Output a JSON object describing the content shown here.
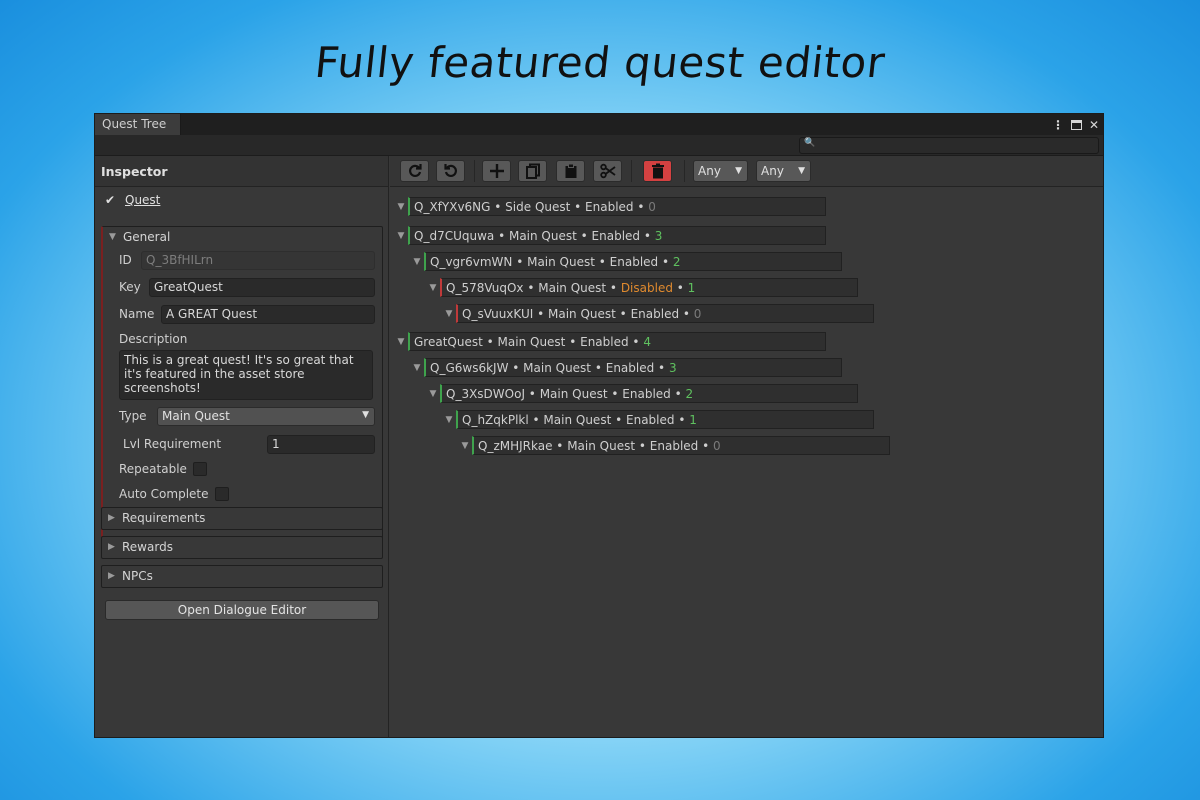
{
  "banner": "Fully featured quest editor",
  "window": {
    "tab": "Quest Tree",
    "controls": {
      "menu": "⋮",
      "close": "✕"
    }
  },
  "inspector": {
    "title": "Inspector",
    "quest_label": "Quest",
    "general": {
      "label": "General",
      "id_label": "ID",
      "id_value": "Q_3BfHILrn",
      "key_label": "Key",
      "key_value": "GreatQuest",
      "name_label": "Name",
      "name_value": "A GREAT Quest",
      "description_label": "Description",
      "description_value": "This is a great quest! It's so great that it's featured in the asset store screenshots!",
      "type_label": "Type",
      "type_value": "Main Quest",
      "lvl_label": "Lvl Requirement",
      "lvl_value": "1",
      "repeatable_label": "Repeatable",
      "autocomplete_label": "Auto Complete"
    },
    "sections": [
      "Requirements",
      "Rewards",
      "NPCs"
    ],
    "open_dialogue": "Open Dialogue Editor"
  },
  "toolbar": {
    "filter1": "Any",
    "filter2": "Any"
  },
  "tree": [
    {
      "id": "Q_XfYXv6NG",
      "type": "Side Quest",
      "status": "Enabled",
      "count": "0"
    },
    {
      "id": "Q_d7CUquwa",
      "type": "Main Quest",
      "status": "Enabled",
      "count": "3"
    },
    {
      "id": "Q_vgr6vmWN",
      "type": "Main Quest",
      "status": "Enabled",
      "count": "2"
    },
    {
      "id": "Q_578VuqOx",
      "type": "Main Quest",
      "status": "Disabled",
      "count": "1"
    },
    {
      "id": "Q_sVuuxKUI",
      "type": "Main Quest",
      "status": "Enabled",
      "count": "0"
    },
    {
      "id": "GreatQuest",
      "type": "Main Quest",
      "status": "Enabled",
      "count": "4"
    },
    {
      "id": "Q_G6ws6kJW",
      "type": "Main Quest",
      "status": "Enabled",
      "count": "3"
    },
    {
      "id": "Q_3XsDWOoJ",
      "type": "Main Quest",
      "status": "Enabled",
      "count": "2"
    },
    {
      "id": "Q_hZqkPlkl",
      "type": "Main Quest",
      "status": "Enabled",
      "count": "1"
    },
    {
      "id": "Q_zMHJRkae",
      "type": "Main Quest",
      "status": "Enabled",
      "count": "0"
    }
  ],
  "colors": {
    "accent_green": "#5fc15f",
    "disabled_orange": "#e08a2e",
    "delete_red": "#d44141"
  }
}
